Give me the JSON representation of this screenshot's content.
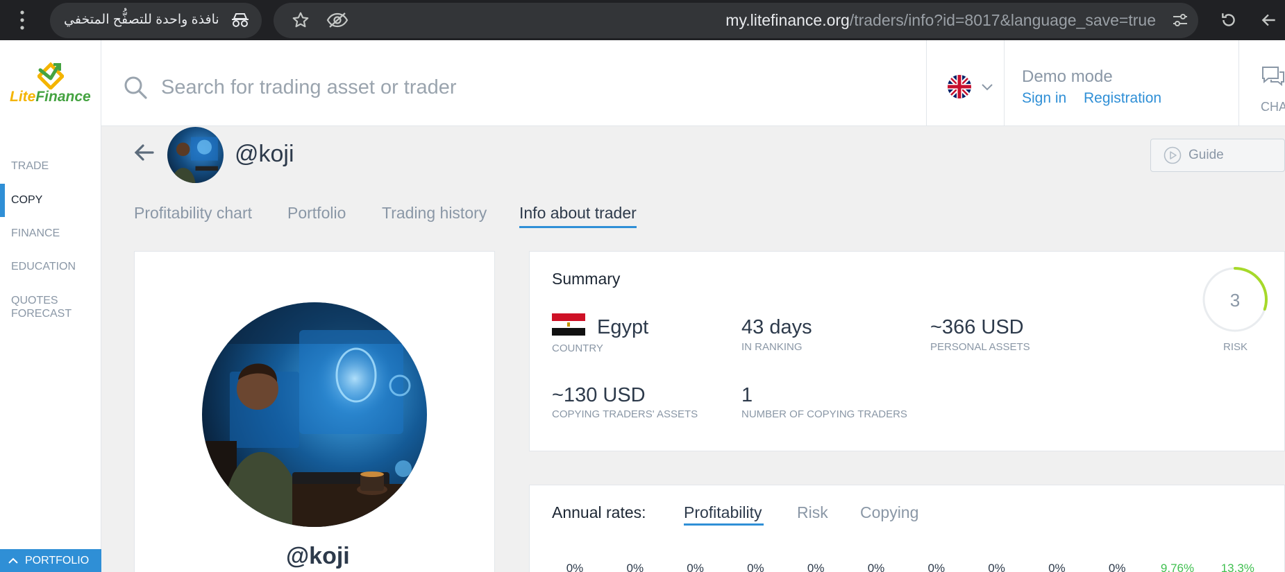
{
  "browser": {
    "window_label": "نافذة واحدة للتصفُّح المتخفي",
    "url_host": "my.litefinance.org",
    "url_path": "/traders/info?id=8017&language_save=true"
  },
  "header": {
    "logo_lite": "Lite",
    "logo_finance": "Finance",
    "search_placeholder": "Search for trading asset or trader",
    "language": "English (UK flag)",
    "demo_mode": "Demo mode",
    "sign_in": "Sign in",
    "registration": "Registration",
    "chat_label": "CHA"
  },
  "sidebar": {
    "items": [
      {
        "label": "TRADE"
      },
      {
        "label": "COPY"
      },
      {
        "label": "FINANCE"
      },
      {
        "label": "EDUCATION"
      },
      {
        "label": "QUOTES FORECAST"
      }
    ],
    "active": "COPY",
    "portfolio": "PORTFOLIO"
  },
  "trader": {
    "name": "@koji",
    "guide": "Guide"
  },
  "tabs": [
    "Profitability chart",
    "Portfolio",
    "Trading history",
    "Info about trader"
  ],
  "active_tab": "Info about trader",
  "summary": {
    "title": "Summary",
    "country": {
      "value": "Egypt",
      "label": "COUNTRY"
    },
    "in_ranking": {
      "value": "43 days",
      "label": "IN RANKING"
    },
    "personal_assets": {
      "value": "~366 USD",
      "label": "PERSONAL ASSETS"
    },
    "risk": {
      "value": "3",
      "label": "RISK",
      "fraction": 0.3
    },
    "copying_assets": {
      "value": "~130 USD",
      "label": "COPYING TRADERS' ASSETS"
    },
    "copying_traders": {
      "value": "1",
      "label": "NUMBER OF COPYING TRADERS"
    }
  },
  "annual_rates": {
    "title": "Annual rates:",
    "tabs": [
      "Profitability",
      "Risk",
      "Copying"
    ],
    "active_tab": "Profitability",
    "values": [
      "0%",
      "0%",
      "0%",
      "0%",
      "0%",
      "0%",
      "0%",
      "0%",
      "0%",
      "0%",
      "9.76%",
      "13.3%"
    ]
  },
  "colors": {
    "accent": "#2f8fd6",
    "positive": "#3fbf4f",
    "risk_arc": "#a6d92a",
    "logo_yellow": "#f4b400",
    "logo_green": "#45a341"
  }
}
